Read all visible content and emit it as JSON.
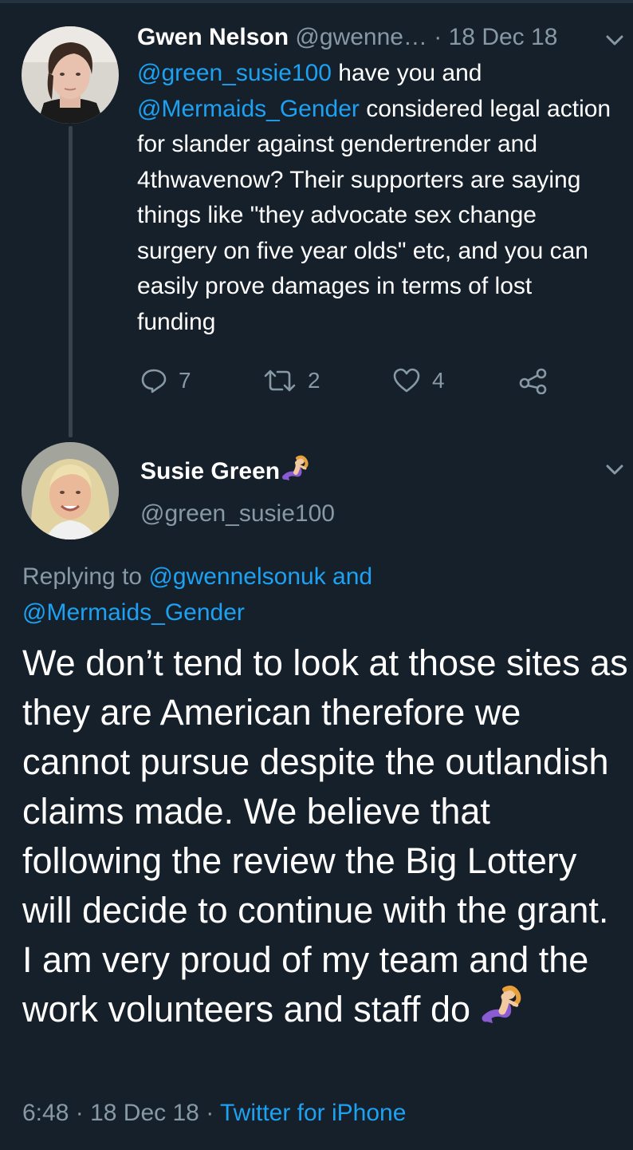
{
  "tweet1": {
    "name": "Gwen Nelson",
    "handle": "@gwenne…",
    "separator": "·",
    "date": "18 Dec 18",
    "body": {
      "mention1": "@green_susie100",
      "text1": " have you and ",
      "mention2": "@Mermaids_Gender",
      "text2": " considered legal action for slander against gendertrender and 4thwavenow? Their supporters are saying things like \"they advocate sex change surgery on five year olds\" etc, and you can easily prove damages in terms of lost funding"
    },
    "actions": {
      "reply_icon": "reply-icon",
      "reply_count": "7",
      "retweet_icon": "retweet-icon",
      "retweet_count": "2",
      "like_icon": "heart-icon",
      "like_count": "4",
      "share_icon": "share-icon"
    }
  },
  "tweet2": {
    "name": "Susie Green",
    "name_emoji": "mermaid-icon",
    "handle": "@green_susie100",
    "replying": {
      "prefix": "Replying to ",
      "user1": "@gwennelsonuk",
      "joiner": " and",
      "user2": "@Mermaids_Gender"
    },
    "body": "We don’t tend to look at those sites as they are American therefore we cannot pursue despite the outlandish claims made. We believe that following the review the Big Lottery will decide to continue with the grant. I am very proud of my team and the work volunteers and staff do",
    "body_emoji": "mermaid-icon",
    "time": "6:48",
    "sep1": "·",
    "date": "18 Dec 18",
    "sep2": "·",
    "source": "Twitter for iPhone"
  },
  "colors": {
    "background": "#15202b",
    "link": "#1da1f2",
    "muted": "#8899a6",
    "text": "#ffffff"
  }
}
